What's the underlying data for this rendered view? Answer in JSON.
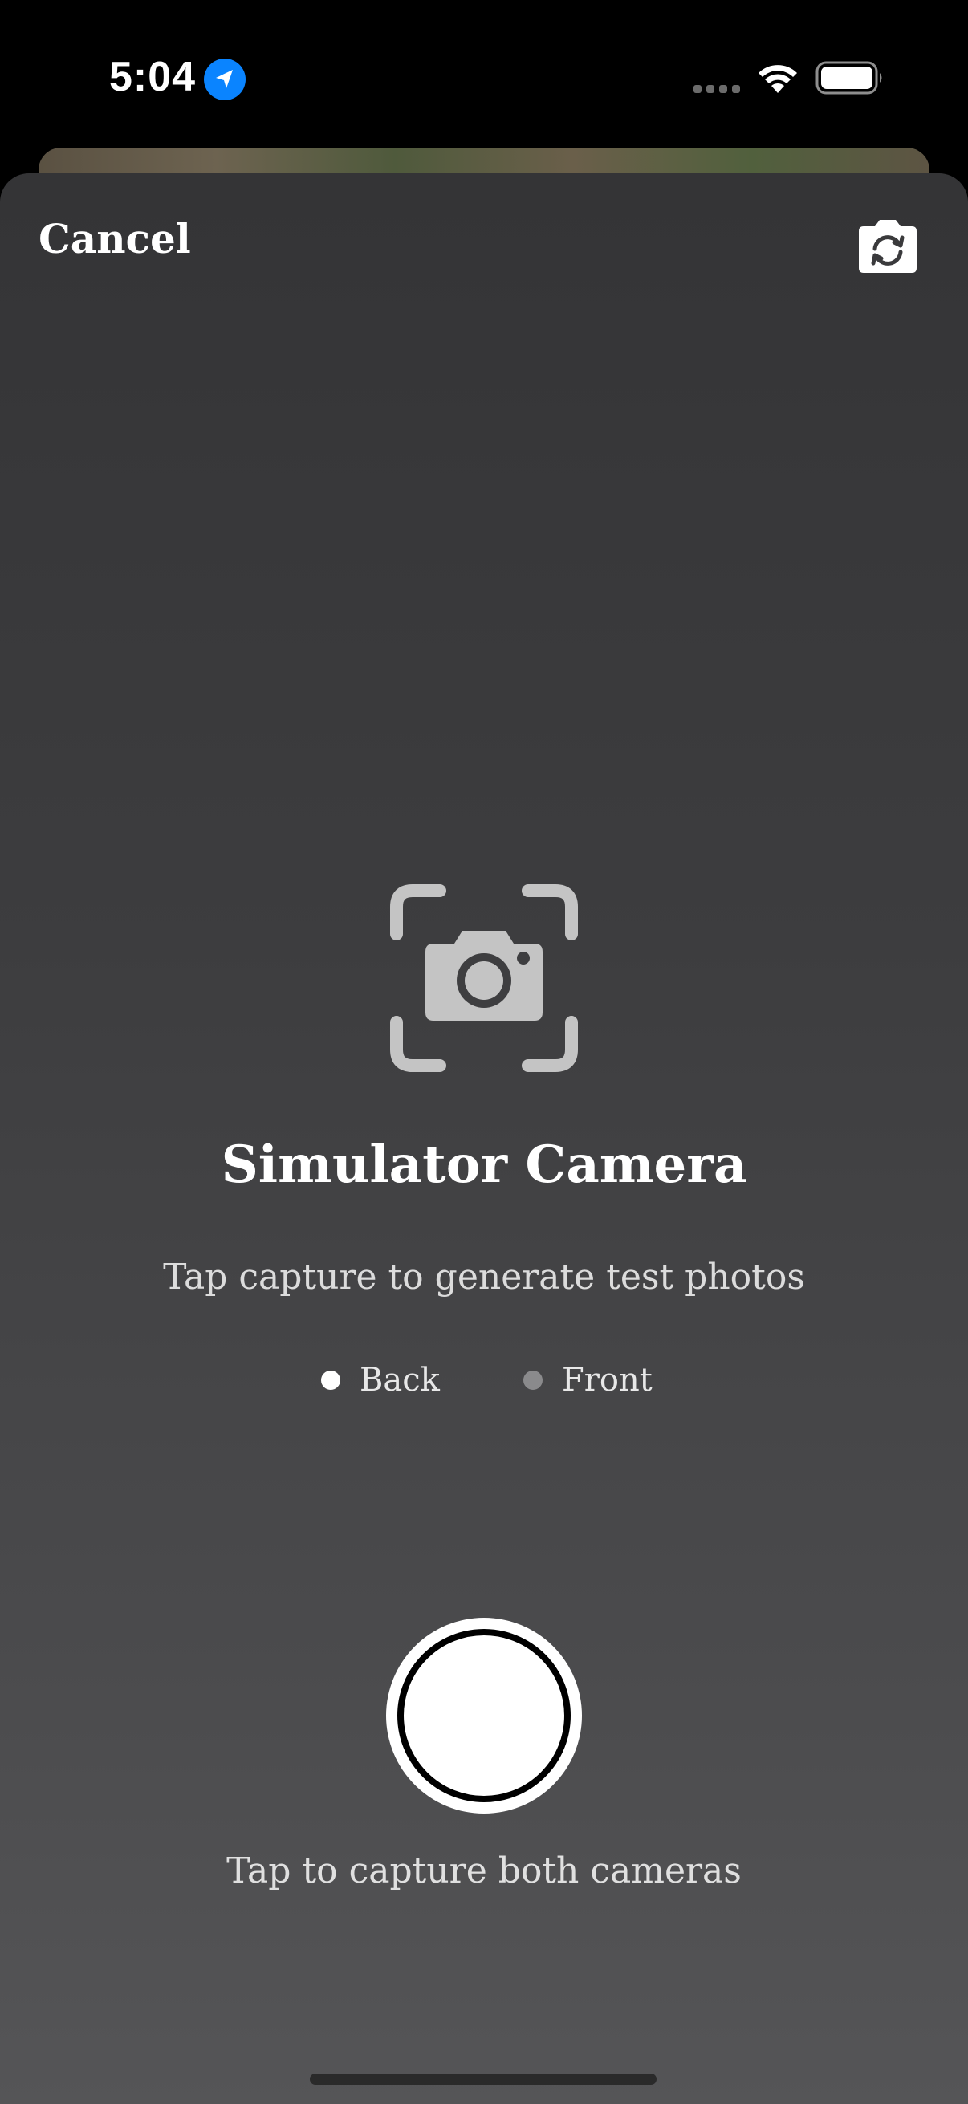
{
  "status_bar": {
    "time": "5:04",
    "location_icon": "location-arrow-icon",
    "signal_icon": "cellular-signal-icon",
    "wifi_icon": "wifi-icon",
    "battery_icon": "battery-icon"
  },
  "header": {
    "cancel_label": "Cancel",
    "switch_camera_icon": "camera-rotate-icon"
  },
  "main": {
    "icon": "camera-viewfinder-icon",
    "title": "Simulator Camera",
    "subtitle": "Tap capture to generate test photos",
    "cameras": [
      {
        "label": "Back",
        "active": true,
        "dot_color": "#ffffff"
      },
      {
        "label": "Front",
        "active": false,
        "dot_color": "#8a8a8c"
      }
    ]
  },
  "capture": {
    "hint": "Tap to capture both cameras"
  },
  "colors": {
    "sheet_top": "#343436",
    "sheet_bottom": "#555557",
    "location_blue": "#0a84ff",
    "icon_gray": "#c4c4c4"
  }
}
